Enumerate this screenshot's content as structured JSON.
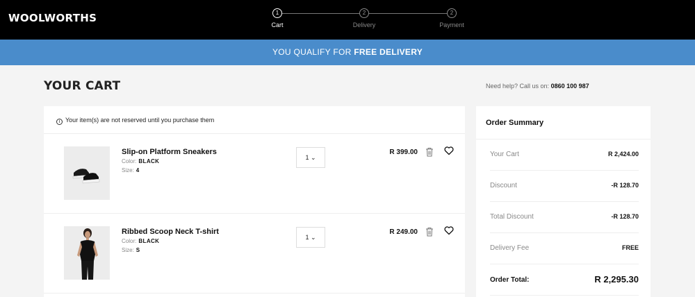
{
  "brand": "WOOLWORTHS",
  "steps": [
    {
      "num": "1",
      "label": "Cart"
    },
    {
      "num": "2",
      "label": "Delivery"
    },
    {
      "num": "2",
      "label": "Payment"
    }
  ],
  "banner": {
    "prefix": "YOU QUALIFY FOR ",
    "emphasis": "FREE DELIVERY"
  },
  "page_title": "YOUR CART",
  "help": {
    "label": "Need help? Call us on:",
    "phone": "0860 100 987"
  },
  "notice": "Your item(s) are not reserved until you purchase them",
  "items": [
    {
      "name": "Slip-on Platform Sneakers",
      "color_label": "Color",
      "color": "BLACK",
      "size_label": "Size",
      "size": "4",
      "qty": "1",
      "price": "R 399.00"
    },
    {
      "name": "Ribbed Scoop Neck T-shirt",
      "color_label": "Color",
      "color": "BLACK",
      "size_label": "Size",
      "size": "S",
      "qty": "1",
      "price": "R 249.00"
    }
  ],
  "summary": {
    "title": "Order Summary",
    "rows": [
      {
        "label": "Your Cart",
        "value": "R 2,424.00"
      },
      {
        "label": "Discount",
        "value": "-R 128.70"
      },
      {
        "label": "Total Discount",
        "value": "-R 128.70"
      },
      {
        "label": "Delivery Fee",
        "value": "FREE"
      }
    ],
    "total_label": "Order Total:",
    "total_value": "R 2,295.30"
  }
}
